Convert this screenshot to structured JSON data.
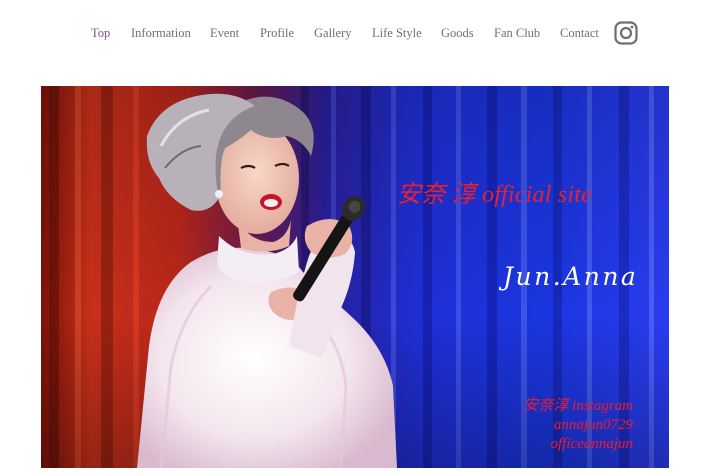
{
  "nav": {
    "items": [
      {
        "label": "Top",
        "active": true
      },
      {
        "label": "Information",
        "active": false
      },
      {
        "label": "Event",
        "active": false
      },
      {
        "label": "Profile",
        "active": false
      },
      {
        "label": "Gallery",
        "active": false
      },
      {
        "label": "Life Style",
        "active": false
      },
      {
        "label": "Goods",
        "active": false
      },
      {
        "label": "Fan Club",
        "active": false
      },
      {
        "label": "Contact",
        "active": false
      }
    ],
    "instagram_icon": "instagram-icon"
  },
  "hero": {
    "title": "安奈 淳 official site",
    "signature": "Jun.Anna",
    "instagram": {
      "heading": "安奈淳 instagram",
      "account_1": "annajun0729",
      "account_2": "officeannajun"
    },
    "photo_subject": "singer-with-microphone"
  },
  "colors": {
    "nav_active": "#9b3fa6",
    "nav_text": "#6f6f6f",
    "hero_title": "#ef1f2a",
    "curtain_red": "#c8281a",
    "curtain_blue": "#1f2fd6"
  }
}
